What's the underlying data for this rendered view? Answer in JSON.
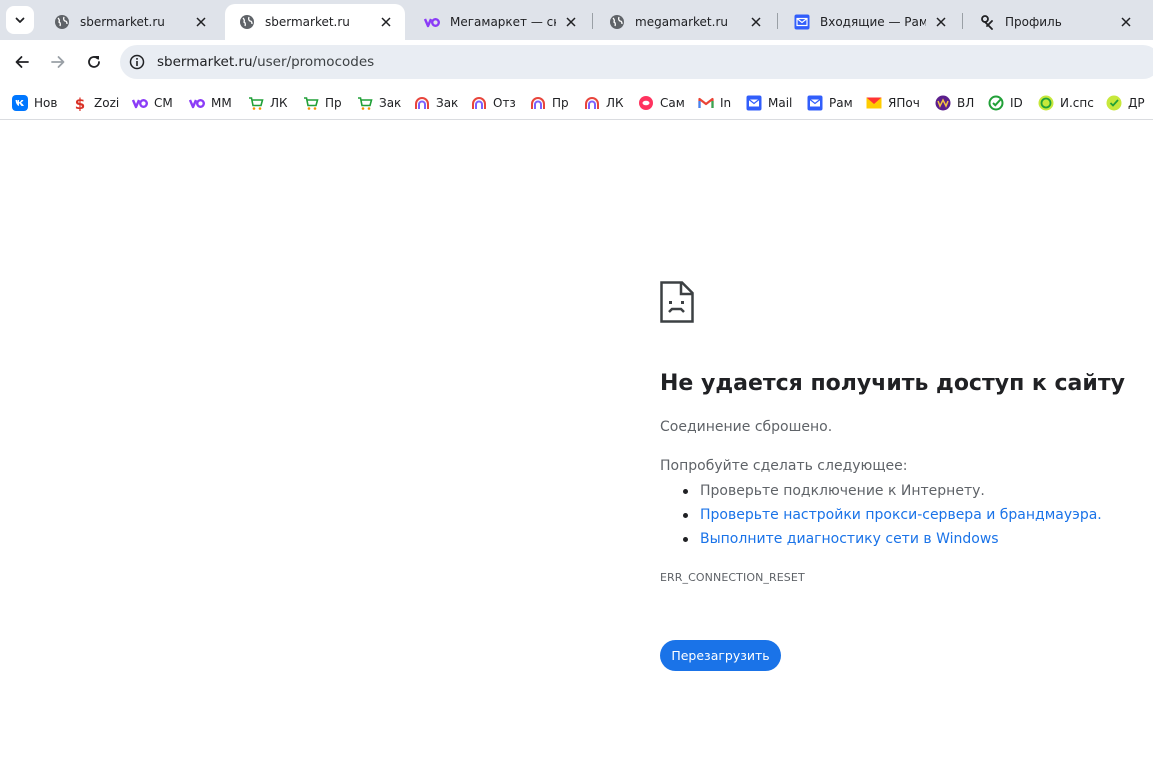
{
  "tabs": [
    {
      "label": "sbermarket.ru",
      "icon": "globe-icon",
      "active": false
    },
    {
      "label": "sbermarket.ru",
      "icon": "globe-icon",
      "active": true
    },
    {
      "label": "Мегамаркет — скидк",
      "icon": "megamarket-icon",
      "active": false
    },
    {
      "label": "megamarket.ru",
      "icon": "globe-icon",
      "active": false
    },
    {
      "label": "Входящие — Рамбле",
      "icon": "rambler-mail-icon",
      "active": false
    },
    {
      "label": "Профиль",
      "icon": "profile-icon",
      "active": false
    }
  ],
  "toolbar": {
    "url_host": "sbermarket.ru",
    "url_path": "/user/promocodes"
  },
  "bookmarks": [
    {
      "label": "Нов",
      "icon": "vk-icon",
      "color": "#0077ff"
    },
    {
      "label": "Zozi",
      "icon": "dollar-icon",
      "color": "#d93025"
    },
    {
      "label": "СМ",
      "icon": "megamarket-icon",
      "color": "#8b3cf7"
    },
    {
      "label": "ММ",
      "icon": "megamarket-icon",
      "color": "#8b3cf7"
    },
    {
      "label": "ЛК",
      "icon": "cart-icon",
      "color": "#21a038"
    },
    {
      "label": "Пр",
      "icon": "cart-icon",
      "color": "#21a038"
    },
    {
      "label": "Зак",
      "icon": "cart-icon",
      "color": "#21a038"
    },
    {
      "label": "Зак",
      "icon": "rainbow-icon",
      "color": "#e8453c"
    },
    {
      "label": "Отз",
      "icon": "rainbow-icon",
      "color": "#e8453c"
    },
    {
      "label": "Пр",
      "icon": "rainbow-icon",
      "color": "#e8453c"
    },
    {
      "label": "ЛК",
      "icon": "rainbow-icon",
      "color": "#e8453c"
    },
    {
      "label": "Сам",
      "icon": "samokat-icon",
      "color": "#ff335f"
    },
    {
      "label": "In",
      "icon": "gmail-icon",
      "color": "#ea4335"
    },
    {
      "label": "Mail",
      "icon": "mail-icon",
      "color": "#315efb"
    },
    {
      "label": "Рам",
      "icon": "mail-icon",
      "color": "#315efb"
    },
    {
      "label": "ЯПоч",
      "icon": "yandex-mail-icon",
      "color": "#ffcc00"
    },
    {
      "label": "ВЛ",
      "icon": "vl-icon",
      "color": "#5b1e8c"
    },
    {
      "label": "ID",
      "icon": "sber-icon",
      "color": "#21a038"
    },
    {
      "label": "И.спс",
      "icon": "sber-icon",
      "color": "#21a038"
    },
    {
      "label": "ДР",
      "icon": "sber-icon",
      "color": "#21a038"
    }
  ],
  "error": {
    "title": "Не удается получить доступ к сайту",
    "subtitle": "Соединение сброшено.",
    "try_label": "Попробуйте сделать следующее:",
    "suggestions": [
      {
        "text": "Проверьте подключение к Интернету.",
        "link": false
      },
      {
        "text": "Проверьте настройки прокси-сервера и брандмауэра.",
        "link": true
      },
      {
        "text": "Выполните диагностику сети в Windows",
        "link": true
      }
    ],
    "code": "ERR_CONNECTION_RESET",
    "reload_label": "Перезагрузить"
  },
  "colors": {
    "accent": "#1a73e8",
    "tabstrip_bg": "#dfe3ea",
    "omnibox_bg": "#e9edf3"
  }
}
